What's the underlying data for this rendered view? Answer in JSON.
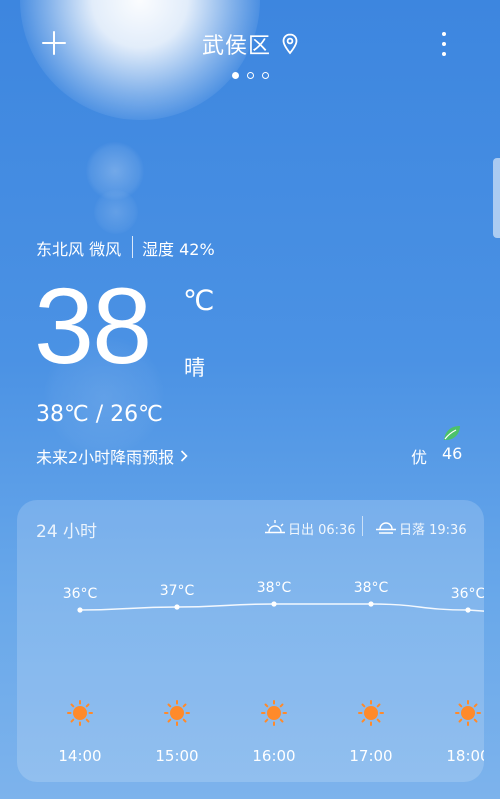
{
  "header": {
    "city": "武侯区",
    "icons": [
      "plus-icon",
      "location-pin-icon",
      "more-vertical-icon"
    ],
    "page_dots": {
      "count": 3,
      "active": 0
    }
  },
  "current": {
    "wind": "东北风 微风",
    "humidity": "湿度 42%",
    "temperature": "38",
    "unit": "℃",
    "condition": "晴",
    "range": "38℃ / 26℃",
    "rain_forecast": "未来2小时降雨预报",
    "aqi_label": "优",
    "aqi_value": "46"
  },
  "hourly": {
    "title": "24 小时",
    "sunrise": "日出 06:36",
    "sunset": "日落 19:36"
  },
  "chart_data": {
    "type": "line",
    "x": [
      "14:00",
      "15:00",
      "16:00",
      "17:00",
      "18:00"
    ],
    "series": [
      {
        "values": [
          36,
          37,
          38,
          38,
          36
        ]
      }
    ],
    "data_labels": [
      "36°C",
      "37°C",
      "38°C",
      "38°C",
      "36°C"
    ],
    "icons": [
      "sun-icon",
      "sun-icon",
      "sun-icon",
      "sun-icon",
      "sun-icon"
    ],
    "colors": {
      "line": "#ffffff",
      "sun": "#ff8a2a"
    }
  }
}
